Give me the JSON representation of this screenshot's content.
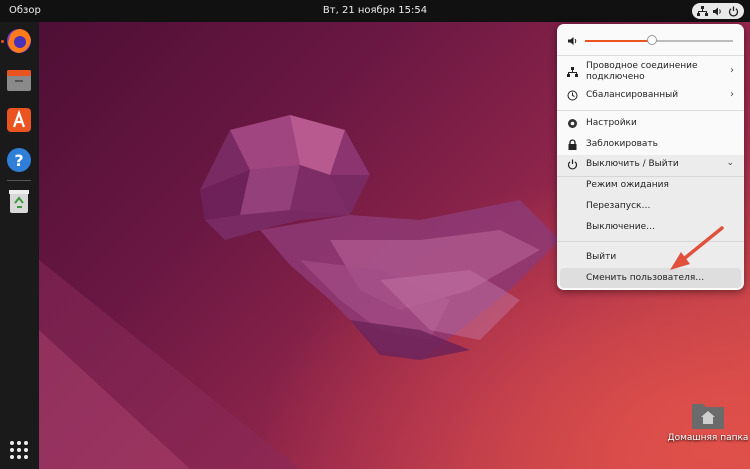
{
  "topbar": {
    "activities_label": "Обзор",
    "clock": "Вт, 21 ноября  15:54",
    "tray_icons": [
      "network-icon",
      "speaker-icon",
      "power-icon"
    ]
  },
  "dock": {
    "apps": [
      {
        "name": "firefox-icon"
      },
      {
        "name": "files-icon"
      },
      {
        "name": "app-center-icon"
      },
      {
        "name": "help-icon"
      },
      {
        "name": "trash-icon"
      }
    ],
    "show_apps": "apps-grid-icon"
  },
  "desktop": {
    "home_folder_label": "Домашняя папка"
  },
  "system_menu": {
    "volume_level": 0.45,
    "network_label": "Проводное соединение подключено",
    "power_mode_label": "Сбалансированный",
    "settings_label": "Настройки",
    "lock_label": "Заблокировать",
    "power_header_label": "Выключить / Выйти",
    "power_submenu": {
      "suspend": "Режим ожидания",
      "restart": "Перезапуск…",
      "shutdown": "Выключение…",
      "logout": "Выйти",
      "switch_user": "Сменить пользователя…"
    }
  },
  "colors": {
    "accent": "#e95420",
    "annotation_arrow": "#e0503c",
    "menu_bg": "#fafafa",
    "topbar_bg": "#111111"
  }
}
